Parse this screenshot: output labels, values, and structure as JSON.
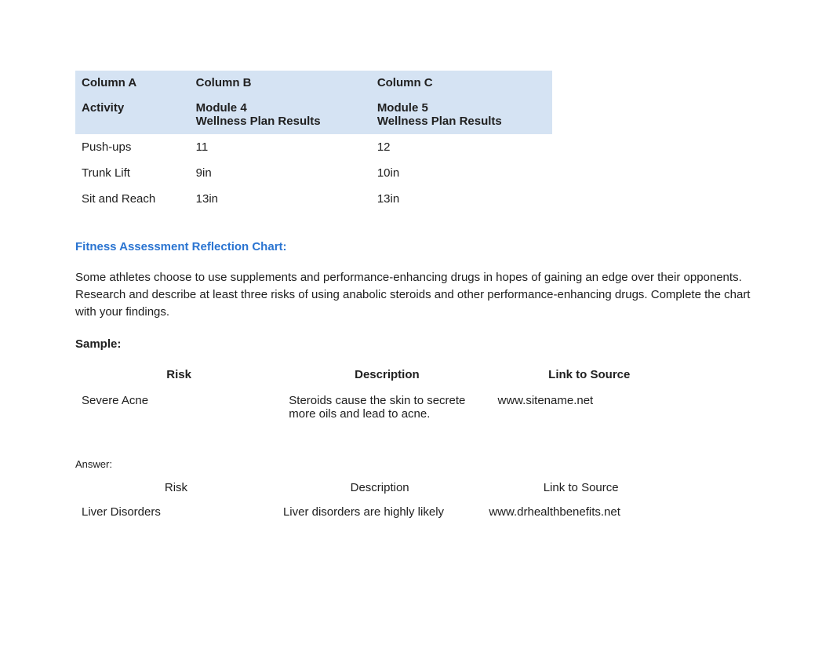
{
  "wellness_table": {
    "header_row1": {
      "colA": "Column A",
      "colB": "Column B",
      "colC": "Column C"
    },
    "header_row2": {
      "activity": "Activity",
      "mod4_line1": "Module 4",
      "mod4_line2": "Wellness Plan Results",
      "mod5_line1": "Module 5",
      "mod5_line2": "Wellness Plan Results"
    },
    "rows": [
      {
        "activity": "Push-ups",
        "mod4": "11",
        "mod5": "12"
      },
      {
        "activity": "Trunk Lift",
        "mod4": "9in",
        "mod5": "10in"
      },
      {
        "activity": "Sit and Reach",
        "mod4": "13in",
        "mod5": "13in"
      }
    ]
  },
  "reflection_title": "Fitness Assessment Reflection Chart:",
  "paragraph": "Some athletes choose to use supplements and performance-enhancing drugs in hopes of gaining an edge over their opponents. Research and describe at least three risks of using anabolic steroids and other performance-enhancing drugs. Complete the chart with your findings.",
  "sample_label": "Sample:",
  "sample_table": {
    "headers": {
      "risk": "Risk",
      "description": "Description",
      "link": "Link to Source"
    },
    "row": {
      "risk": "Severe Acne",
      "description": "Steroids cause the skin to secrete more oils and lead to acne.",
      "link": "www.sitename.net"
    }
  },
  "answer_label": "Answer:",
  "answer_table": {
    "headers": {
      "risk": "Risk",
      "description": "Description",
      "link": "Link to Source"
    },
    "row": {
      "risk": "Liver Disorders",
      "description": "Liver disorders are highly likely",
      "link": "www.drhealthbenefits.net"
    }
  }
}
